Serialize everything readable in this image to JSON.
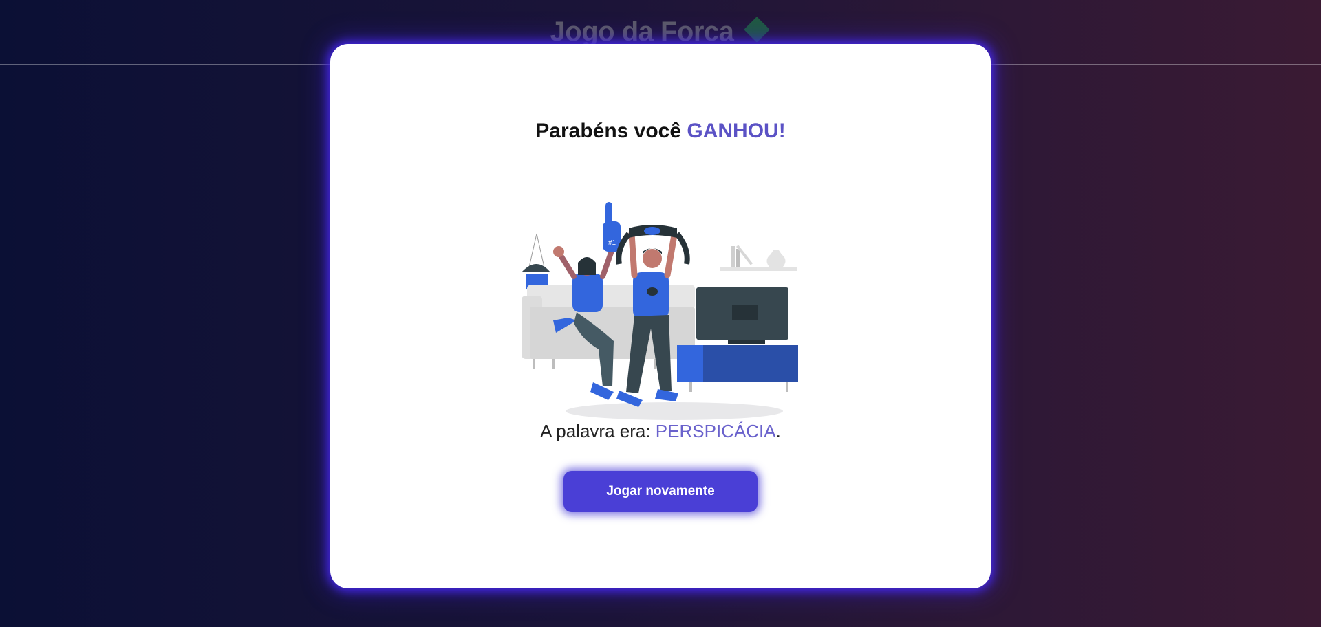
{
  "header": {
    "title": "Jogo da Forca",
    "icon": "puzzle-piece-icon"
  },
  "modal": {
    "title_prefix": "Parabéns você ",
    "title_highlight": "GANHOU!",
    "illustration": "celebrating-fans-illustration",
    "word_prefix": "A palavra era: ",
    "word": "PERSPICÁCIA",
    "word_suffix": ".",
    "play_again_label": "Jogar novamente"
  },
  "colors": {
    "accent": "#4a3fd6",
    "highlight": "#5b52c5",
    "puzzle_icon": "#1f5a3f"
  }
}
